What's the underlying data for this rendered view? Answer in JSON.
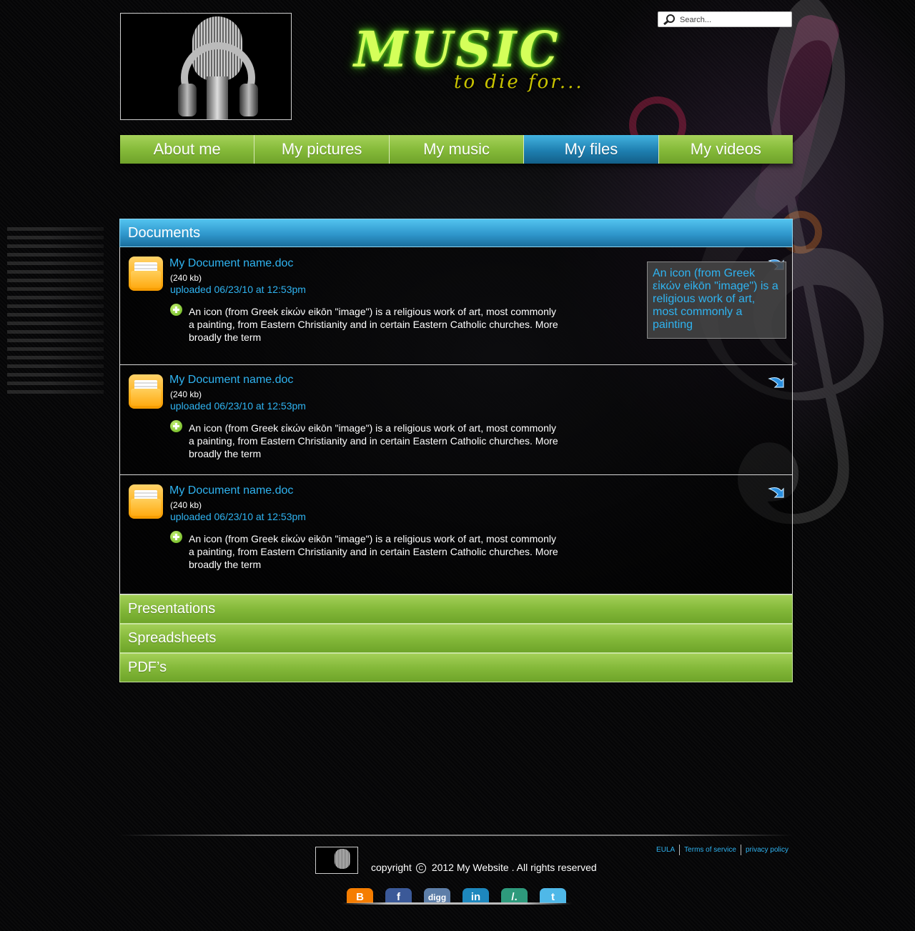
{
  "header": {
    "brand_title": "MUSIC",
    "brand_subtitle": "to die for...",
    "search_placeholder": "Search..."
  },
  "nav": {
    "items": [
      {
        "label": "About me"
      },
      {
        "label": "My pictures"
      },
      {
        "label": "My music"
      },
      {
        "label": "My files",
        "active": true
      },
      {
        "label": "My videos"
      }
    ]
  },
  "documents": {
    "title": "Documents",
    "items": [
      {
        "name": "My Document name.doc",
        "size": "(240 kb)",
        "uploaded": "uploaded 06/23/10 at 12:53pm",
        "description": "An icon (from Greek εἰκών eikōn \"image\") is a religious work of art, most commonly a painting, from Eastern Christianity and in certain Eastern Catholic churches. More broadly the term"
      },
      {
        "name": "My Document name.doc",
        "size": "(240 kb)",
        "uploaded": "uploaded 06/23/10 at 12:53pm",
        "description": "An icon (from Greek εἰκών eikōn \"image\") is a religious work of art, most commonly a painting, from Eastern Christianity and in certain Eastern Catholic churches. More broadly the term"
      },
      {
        "name": "My Document name.doc",
        "size": "(240 kb)",
        "uploaded": "uploaded 06/23/10 at 12:53pm",
        "description": "An icon (from Greek εἰκών eikōn \"image\") is a religious work of art, most commonly a painting, from Eastern Christianity and in certain Eastern Catholic churches. More broadly the term"
      }
    ],
    "tooltip": "An icon (from Greek εἰκών eikōn \"image\") is a religious work of art, most commonly a painting"
  },
  "sections": {
    "presentations": "Presentations",
    "spreadsheets": "Spreadsheets",
    "pdfs": "PDF’s"
  },
  "footer": {
    "copyright_prefix": "copyright",
    "copyright_text": "2012 My Website . All rights reserved",
    "links": {
      "eula": "EULA",
      "terms": "Terms of service",
      "privacy": "privacy policy"
    },
    "social": [
      {
        "icon": "blogger-icon",
        "color": "#f57d00"
      },
      {
        "icon": "facebook-icon",
        "color": "#3b5998"
      },
      {
        "icon": "digg-icon",
        "color": "#5d7ea8"
      },
      {
        "icon": "linkedin-icon",
        "color": "#1d87bd"
      },
      {
        "icon": "slashdot-icon",
        "color": "#2e9a7c"
      },
      {
        "icon": "twitter-icon",
        "color": "#4fb8e8"
      }
    ]
  },
  "colors": {
    "accent_blue": "#2fb3f0",
    "nav_green": "#86bb3a",
    "active_blue": "#1e7fb0"
  }
}
